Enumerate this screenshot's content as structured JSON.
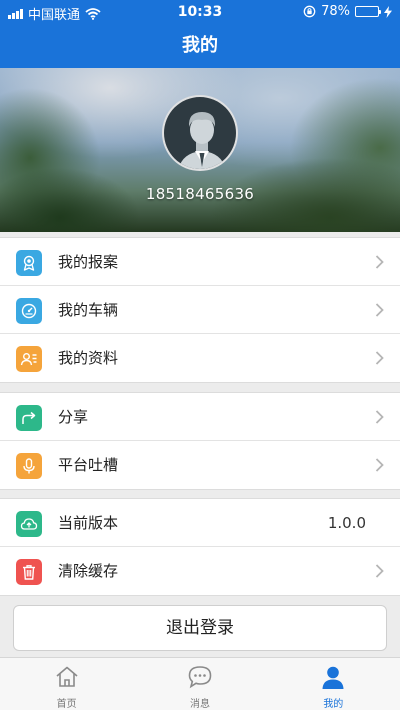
{
  "status_bar": {
    "carrier": "中国联通",
    "time": "10:33",
    "battery_percent": "78%",
    "battery_level": 0.78
  },
  "nav": {
    "title": "我的"
  },
  "profile": {
    "phone": "18518465636"
  },
  "groups": [
    {
      "items": [
        {
          "label": "我的报案",
          "icon": "award-ribbon-icon",
          "color": "#3aa8e2"
        },
        {
          "label": "我的车辆",
          "icon": "speedometer-icon",
          "color": "#3aa8e2"
        },
        {
          "label": "我的资料",
          "icon": "profile-card-icon",
          "color": "#f5a43b"
        }
      ]
    },
    {
      "items": [
        {
          "label": "分享",
          "icon": "share-icon",
          "color": "#2db88a"
        },
        {
          "label": "平台吐槽",
          "icon": "microphone-icon",
          "color": "#f5a43b"
        }
      ]
    },
    {
      "items": [
        {
          "label": "当前版本",
          "icon": "cloud-upload-icon",
          "color": "#2db88a",
          "value": "1.0.0"
        },
        {
          "label": "清除缓存",
          "icon": "trash-icon",
          "color": "#ef5350"
        }
      ]
    }
  ],
  "logout_label": "退出登录",
  "tabs": [
    {
      "label": "首页",
      "icon": "home-icon",
      "active": false
    },
    {
      "label": "消息",
      "icon": "message-icon",
      "active": false
    },
    {
      "label": "我的",
      "icon": "user-icon",
      "active": true
    }
  ],
  "colors": {
    "primary": "#1a73d9",
    "page_bg": "#ececec"
  }
}
